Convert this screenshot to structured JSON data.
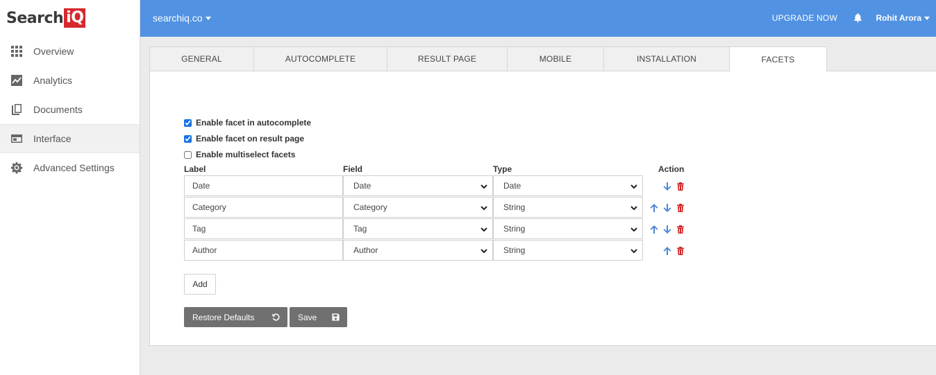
{
  "brand": {
    "logo_text": "Search",
    "logo_badge": "iQ"
  },
  "sidebar": {
    "items": [
      {
        "label": "Overview",
        "icon": "grid-icon"
      },
      {
        "label": "Analytics",
        "icon": "chart-icon"
      },
      {
        "label": "Documents",
        "icon": "documents-icon"
      },
      {
        "label": "Interface",
        "icon": "interface-icon",
        "active": true
      },
      {
        "label": "Advanced Settings",
        "icon": "gear-icon"
      }
    ]
  },
  "header": {
    "site": "searchiq.co",
    "upgrade": "UPGRADE NOW",
    "user": "Rohit Arora",
    "accent_color": "#5192e3"
  },
  "tabs": [
    {
      "label": "GENERAL"
    },
    {
      "label": "AUTOCOMPLETE"
    },
    {
      "label": "RESULT PAGE"
    },
    {
      "label": "MOBILE"
    },
    {
      "label": "INSTALLATION"
    },
    {
      "label": "FACETS",
      "active": true
    }
  ],
  "facets": {
    "options": [
      {
        "label": "Enable facet in autocomplete",
        "checked": true
      },
      {
        "label": "Enable facet on result page",
        "checked": true
      },
      {
        "label": "Enable multiselect facets",
        "checked": false
      }
    ],
    "columns": {
      "label": "Label",
      "field": "Field",
      "type": "Type",
      "action": "Action"
    },
    "rows": [
      {
        "label": "Date",
        "field": "Date",
        "type": "Date",
        "actions": [
          "down",
          "delete"
        ]
      },
      {
        "label": "Category",
        "field": "Category",
        "type": "String",
        "actions": [
          "up",
          "down",
          "delete"
        ]
      },
      {
        "label": "Tag",
        "field": "Tag",
        "type": "String",
        "actions": [
          "up",
          "down",
          "delete"
        ]
      },
      {
        "label": "Author",
        "field": "Author",
        "type": "String",
        "actions": [
          "up",
          "delete"
        ]
      }
    ],
    "add_label": "Add",
    "restore_label": "Restore Defaults",
    "save_label": "Save"
  },
  "colors": {
    "arrow": "#4a86d4",
    "delete": "#d42020",
    "button_dark": "#707070"
  }
}
